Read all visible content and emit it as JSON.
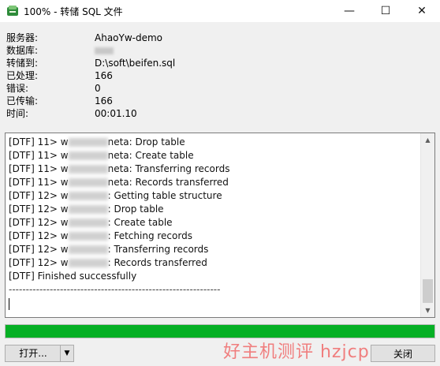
{
  "window": {
    "title": "100% - 转储 SQL 文件",
    "minimize_glyph": "—",
    "maximize_glyph": "☐",
    "close_glyph": "✕",
    "accent": "#06b025"
  },
  "info": [
    {
      "label": "服务器:",
      "value": "AhaoYw-demo"
    },
    {
      "label": "数据库:",
      "value": ""
    },
    {
      "label": "转储到:",
      "value": "D:\\soft\\beifen.sql"
    },
    {
      "label": "已处理:",
      "value": "166"
    },
    {
      "label": "错误:",
      "value": "0"
    },
    {
      "label": "已传输:",
      "value": "166"
    },
    {
      "label": "时间:",
      "value": "00:01.10"
    }
  ],
  "log": {
    "lines": [
      {
        "prefix": "[DTF] 11> w",
        "suffix": "neta: Drop table"
      },
      {
        "prefix": "[DTF] 11> w",
        "suffix": "neta: Create table"
      },
      {
        "prefix": "[DTF] 11> w",
        "suffix": "neta: Transferring records"
      },
      {
        "prefix": "[DTF] 11> w",
        "suffix": "neta: Records transferred"
      },
      {
        "prefix": "[DTF] 12> w",
        "suffix": ": Getting table structure"
      },
      {
        "prefix": "[DTF] 12> w",
        "suffix": ": Drop table"
      },
      {
        "prefix": "[DTF] 12> w",
        "suffix": ": Create table"
      },
      {
        "prefix": "[DTF] 12> w",
        "suffix": ": Fetching records"
      },
      {
        "prefix": "[DTF] 12> w",
        "suffix": ": Transferring records"
      },
      {
        "prefix": "[DTF] 12> w",
        "suffix": ": Records transferred"
      }
    ],
    "finished": "[DTF] Finished successfully",
    "separator": "--------------------------------------------------------------"
  },
  "progress": {
    "percent": 100
  },
  "buttons": {
    "open_label": "打开...",
    "open_arrow": "▼",
    "close_label": "关闭"
  },
  "watermark": "好主机测评 hzjcp.com"
}
